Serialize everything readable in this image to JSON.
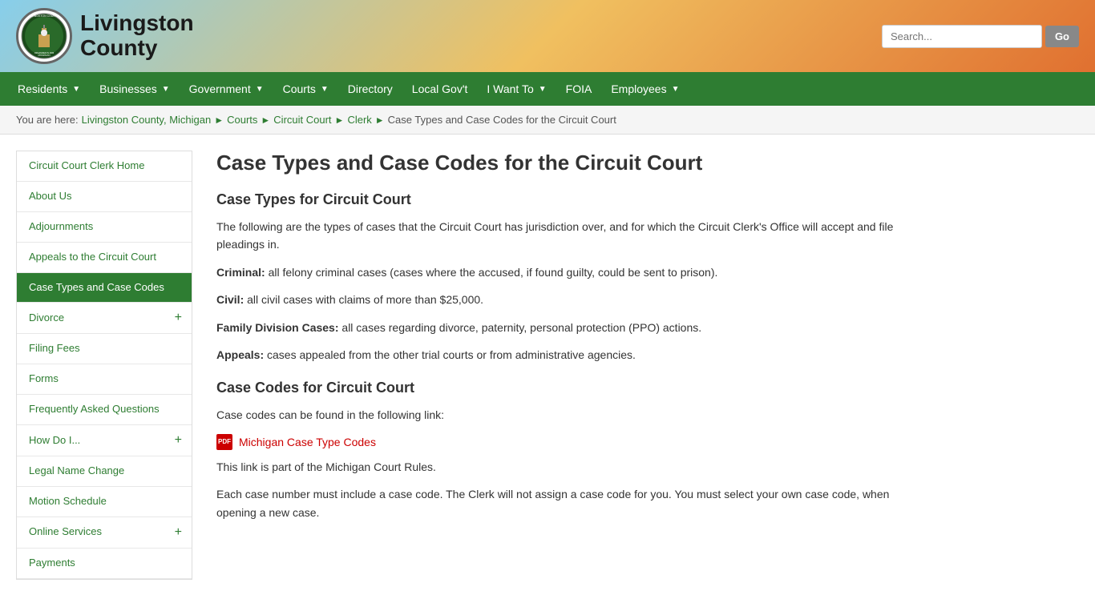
{
  "header": {
    "county_name_line1": "Livingston",
    "county_name_line2": "County",
    "search_placeholder": "Search...",
    "go_label": "Go"
  },
  "nav": {
    "items": [
      {
        "label": "Residents",
        "has_arrow": true
      },
      {
        "label": "Businesses",
        "has_arrow": true
      },
      {
        "label": "Government",
        "has_arrow": true
      },
      {
        "label": "Courts",
        "has_arrow": true
      },
      {
        "label": "Directory",
        "has_arrow": false
      },
      {
        "label": "Local Gov't",
        "has_arrow": false
      },
      {
        "label": "I Want To",
        "has_arrow": true
      },
      {
        "label": "FOIA",
        "has_arrow": false
      },
      {
        "label": "Employees",
        "has_arrow": true
      }
    ]
  },
  "breadcrumb": {
    "you_are_here": "You are here:",
    "items": [
      {
        "label": "Livingston County, Michigan",
        "link": true
      },
      {
        "label": "Courts",
        "link": true
      },
      {
        "label": "Circuit Court",
        "link": true
      },
      {
        "label": "Clerk",
        "link": true
      },
      {
        "label": "Case Types and Case Codes for the Circuit Court",
        "link": false
      }
    ]
  },
  "sidebar": {
    "items": [
      {
        "label": "Circuit Court Clerk Home",
        "active": false,
        "has_plus": false
      },
      {
        "label": "About Us",
        "active": false,
        "has_plus": false
      },
      {
        "label": "Adjournments",
        "active": false,
        "has_plus": false
      },
      {
        "label": "Appeals to the Circuit Court",
        "active": false,
        "has_plus": false
      },
      {
        "label": "Case Types and Case Codes",
        "active": true,
        "has_plus": false
      },
      {
        "label": "Divorce",
        "active": false,
        "has_plus": true
      },
      {
        "label": "Filing Fees",
        "active": false,
        "has_plus": false
      },
      {
        "label": "Forms",
        "active": false,
        "has_plus": false
      },
      {
        "label": "Frequently Asked Questions",
        "active": false,
        "has_plus": false
      },
      {
        "label": "How Do I...",
        "active": false,
        "has_plus": true
      },
      {
        "label": "Legal Name Change",
        "active": false,
        "has_plus": false
      },
      {
        "label": "Motion Schedule",
        "active": false,
        "has_plus": false
      },
      {
        "label": "Online Services",
        "active": false,
        "has_plus": true
      },
      {
        "label": "Payments",
        "active": false,
        "has_plus": false
      }
    ]
  },
  "content": {
    "page_title": "Case Types and Case Codes for the Circuit Court",
    "section1_heading": "Case Types for Circuit Court",
    "section1_intro": "The following are the types of cases that the Circuit Court has jurisdiction over, and for which the Circuit Clerk's Office will accept and file pleadings in.",
    "criminal_label": "Criminal:",
    "criminal_text": " all felony criminal cases (cases where the accused, if found guilty, could be sent to prison).",
    "civil_label": "Civil:",
    "civil_text": " all civil cases with claims of more than $25,000.",
    "family_label": "Family Division Cases:",
    "family_text": " all cases regarding divorce, paternity, personal protection (PPO) actions.",
    "appeals_label": "Appeals:",
    "appeals_text": " cases appealed from the other trial courts or from administrative agencies.",
    "section2_heading": "Case Codes for Circuit Court",
    "section2_intro": "Case codes can be found in the following link:",
    "pdf_link_text": "Michigan Case Type Codes",
    "note1": "This link is part of the Michigan Court Rules.",
    "note2": "Each case number must include a case code. The Clerk will not assign a case code for you. You must select your own case code, when opening a new case."
  }
}
